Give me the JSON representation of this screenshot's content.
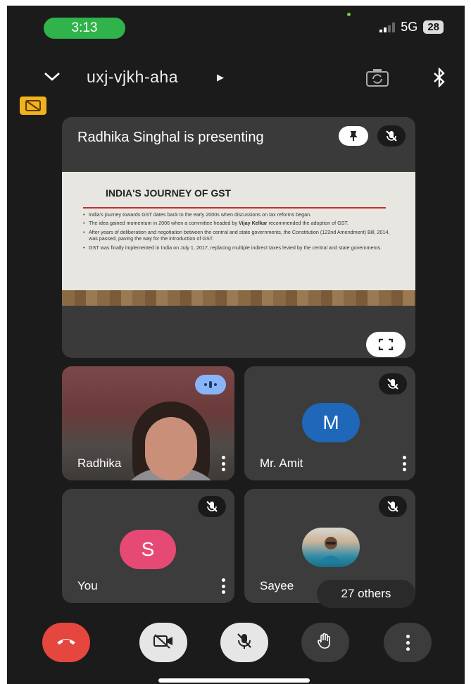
{
  "status": {
    "time": "3:13",
    "network": "5G",
    "battery": "28"
  },
  "meeting": {
    "code": "uxj-vjkh-aha"
  },
  "presentation": {
    "presenter_text": "Radhika Singhal is presenting",
    "slide_title": "INDIA'S JOURNEY OF GST",
    "bullets": [
      {
        "text": "India's journey towards GST dates back to the early 2000s when discussions on tax reforms began."
      },
      {
        "pre": "The idea gained momentum in 2006 when a committee headed by ",
        "bold": "Vijay Kelkar",
        "post": " recommended the adoption of GST."
      },
      {
        "text": "After years of deliberation and negotiation between the central and state governments, the Constitution (122nd Amendment) Bill, 2014, was passed, paving the way for the introduction of GST."
      },
      {
        "text": "GST was finally implemented in India on July 1, 2017, replacing multiple indirect taxes levied by the central and state governments."
      }
    ]
  },
  "participants": {
    "radhika": {
      "name": "Radhika"
    },
    "amit": {
      "name": "Mr. Amit",
      "initial": "M",
      "color": "#1f67b8"
    },
    "you": {
      "name": "You",
      "initial": "S",
      "color": "#e64a74"
    },
    "sayeed": {
      "name": "Sayee",
      "others": "27 others"
    }
  },
  "colors": {
    "end_call": "#e5463e",
    "control": "#3c3c3c",
    "control_light": "#e6e6e6"
  },
  "icons": [
    "chevron-down-icon",
    "play-triangle-icon",
    "camera-switch-icon",
    "bluetooth-icon",
    "captions-off-icon",
    "pin-icon",
    "mic-off-icon",
    "fullscreen-icon",
    "more-vert-icon",
    "end-call-icon",
    "video-off-icon",
    "hand-raise-icon"
  ]
}
